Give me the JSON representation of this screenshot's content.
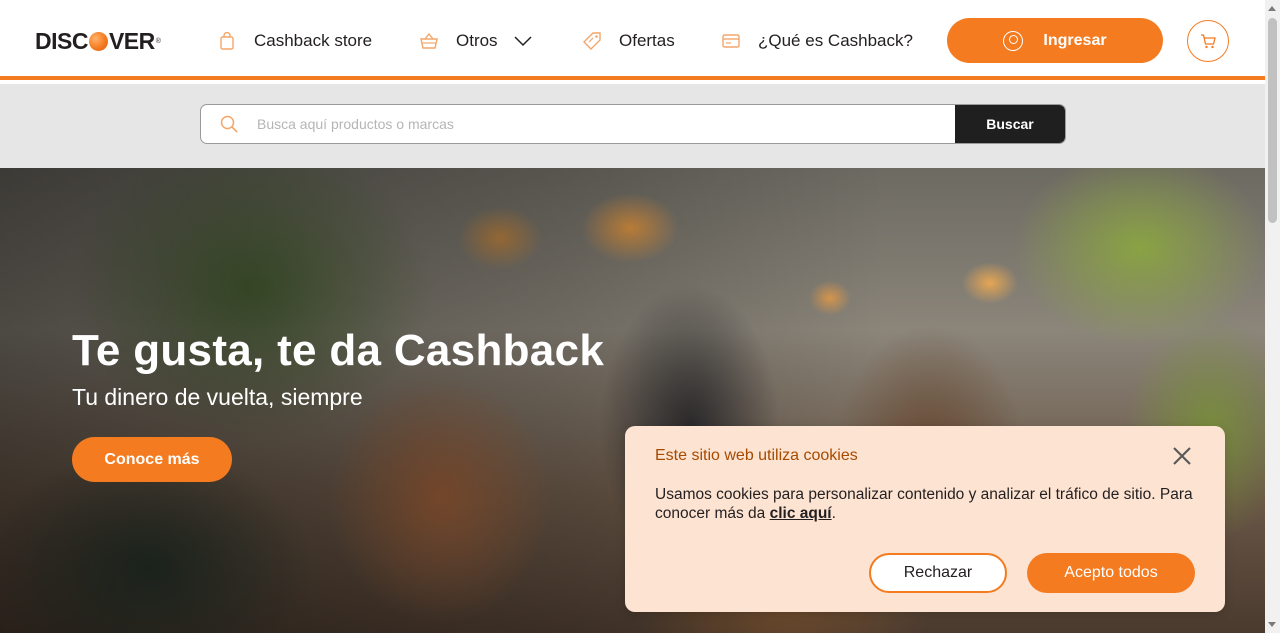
{
  "header": {
    "logo_text_1": "DISC",
    "logo_text_2": "VER",
    "nav": [
      {
        "label": "Cashback store",
        "icon": "shopping-bag-icon"
      },
      {
        "label": "Otros",
        "icon": "basket-icon"
      },
      {
        "label": "Ofertas",
        "icon": "tag-icon"
      },
      {
        "label": "¿Qué es Cashback?",
        "icon": "card-icon"
      }
    ],
    "login_label": "Ingresar",
    "cart_icon": "cart-icon"
  },
  "search": {
    "placeholder": "Busca aquí productos o marcas",
    "button_label": "Buscar"
  },
  "hero": {
    "title": "Te gusta, te da Cashback",
    "subtitle": "Tu dinero de vuelta, siempre",
    "cta_label": "Conoce más"
  },
  "cookie_banner": {
    "title": "Este sitio web utiliza cookies",
    "text": "Usamos cookies para personalizar contenido y analizar el tráfico de sitio. Para conocer más da ",
    "link_label": "clic aquí",
    "text_end": ".",
    "reject_label": "Rechazar",
    "accept_label": "Acepto todos"
  },
  "colors": {
    "brand_orange": "#f47b20",
    "dark": "#1f1f1f",
    "cookie_bg": "#fde3d2"
  }
}
